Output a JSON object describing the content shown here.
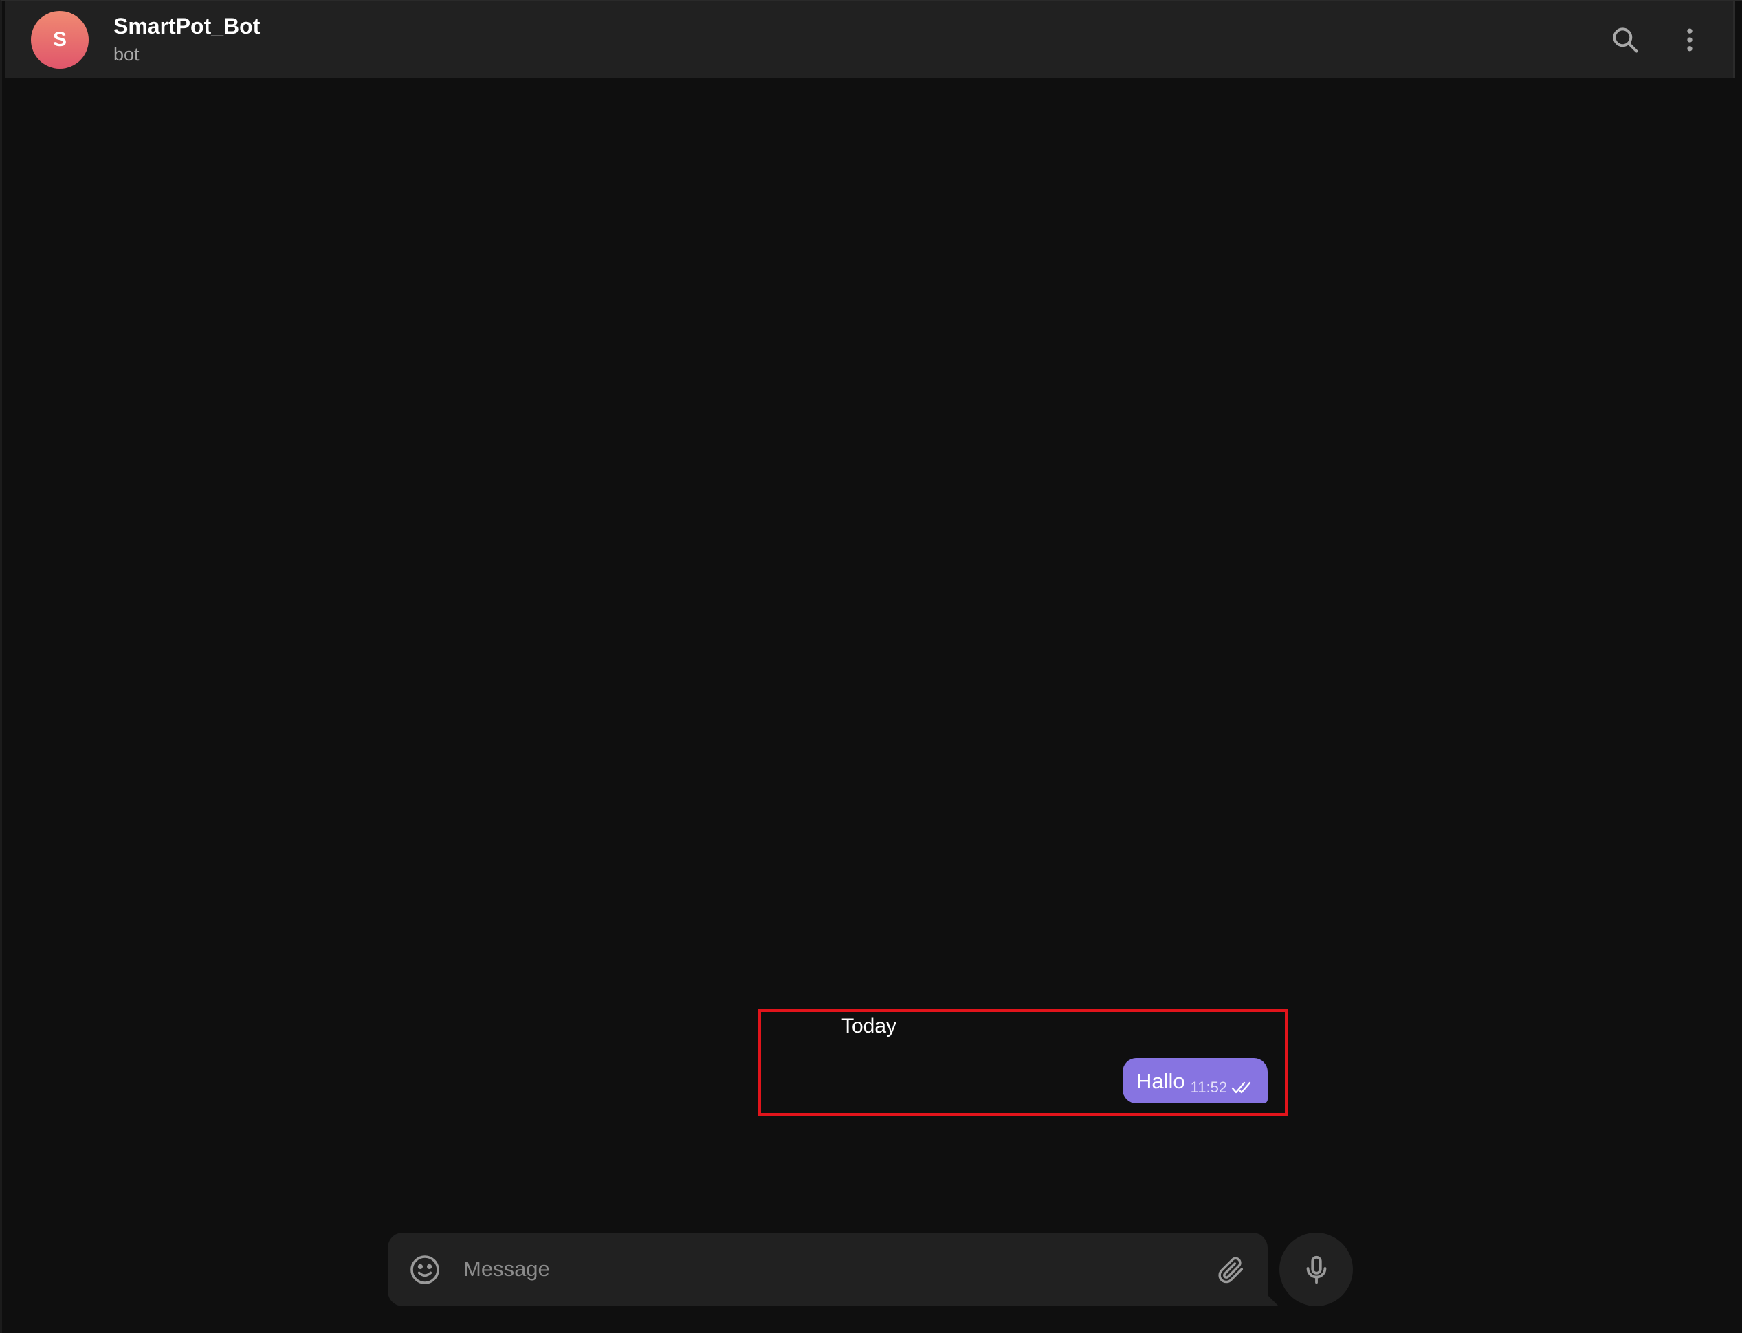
{
  "header": {
    "avatar_letter": "S",
    "title": "SmartPot_Bot",
    "subtitle": "bot",
    "icons": [
      "search-icon",
      "more-vertical-icon"
    ]
  },
  "chat": {
    "date_separator": "Today",
    "messages": [
      {
        "text": "Hallo",
        "time": "11:52",
        "outgoing": true,
        "status": "read"
      }
    ]
  },
  "composer": {
    "placeholder": "Message",
    "value": "",
    "icons": [
      "emoji-icon",
      "paperclip-icon",
      "microphone-icon"
    ]
  },
  "colors": {
    "background": "#0f0f0f",
    "header_bg": "#212121",
    "bubble_bg": "#8774e1",
    "avatar_top": "#f08a72",
    "avatar_bottom": "#e0566b",
    "highlight_border": "#e1141b"
  }
}
